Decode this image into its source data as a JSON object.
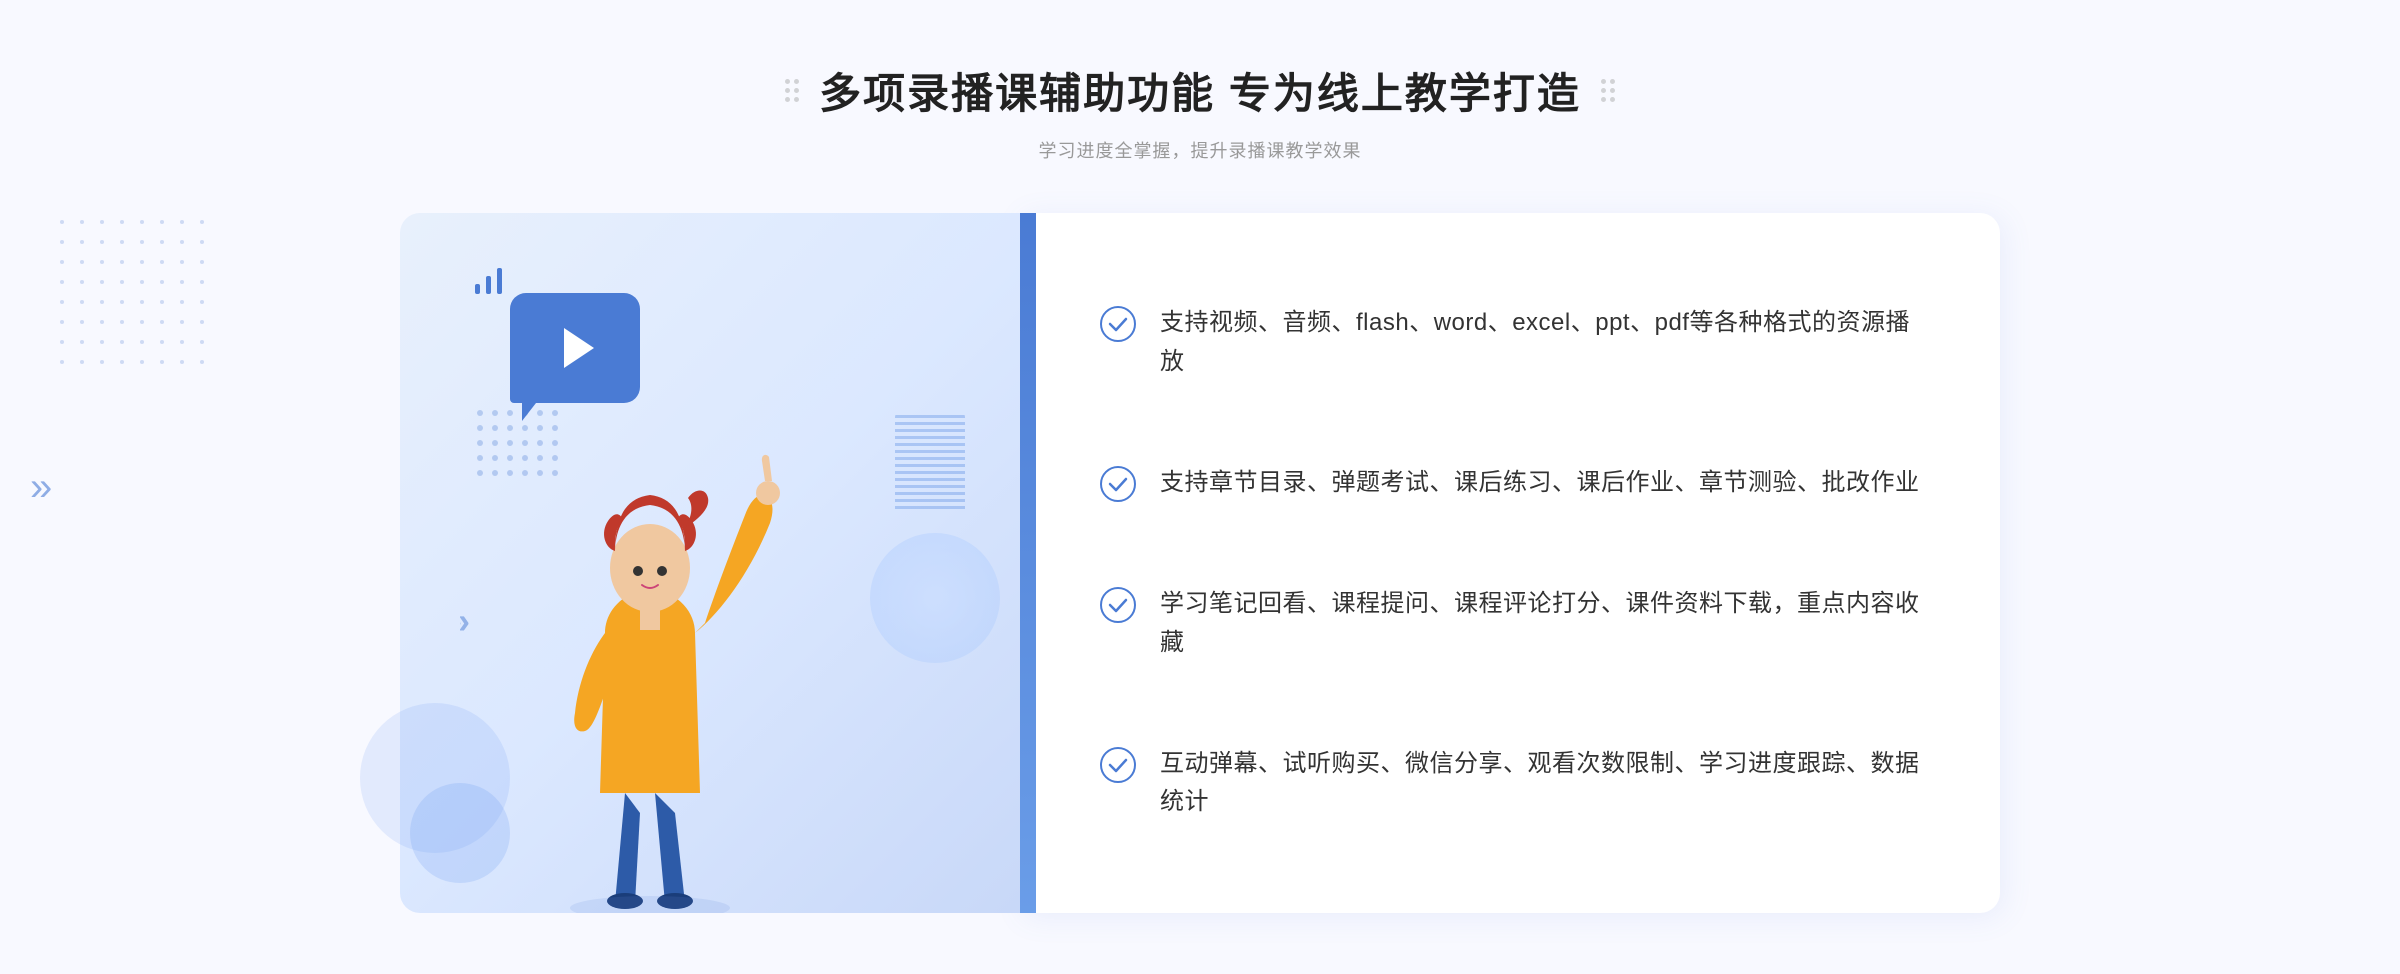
{
  "page": {
    "background": "#f8f9ff"
  },
  "header": {
    "title": "多项录播课辅助功能 专为线上教学打造",
    "subtitle": "学习进度全掌握，提升录播课教学效果",
    "left_dots_icon": "decorative-dots",
    "right_dots_icon": "decorative-dots"
  },
  "features": [
    {
      "id": 1,
      "text": "支持视频、音频、flash、word、excel、ppt、pdf等各种格式的资源播放"
    },
    {
      "id": 2,
      "text": "支持章节目录、弹题考试、课后练习、课后作业、章节测验、批改作业"
    },
    {
      "id": 3,
      "text": "学习笔记回看、课程提问、课程评论打分、课件资料下载，重点内容收藏"
    },
    {
      "id": 4,
      "text": "互动弹幕、试听购买、微信分享、观看次数限制、学习进度跟踪、数据统计"
    }
  ],
  "illustration": {
    "play_bubble_color": "#4a7bd4",
    "bar_color": "#4a7bd4",
    "bg_gradient_start": "#e8f0fc",
    "bg_gradient_end": "#c8d8f8"
  },
  "chevron": {
    "symbol": "»"
  }
}
